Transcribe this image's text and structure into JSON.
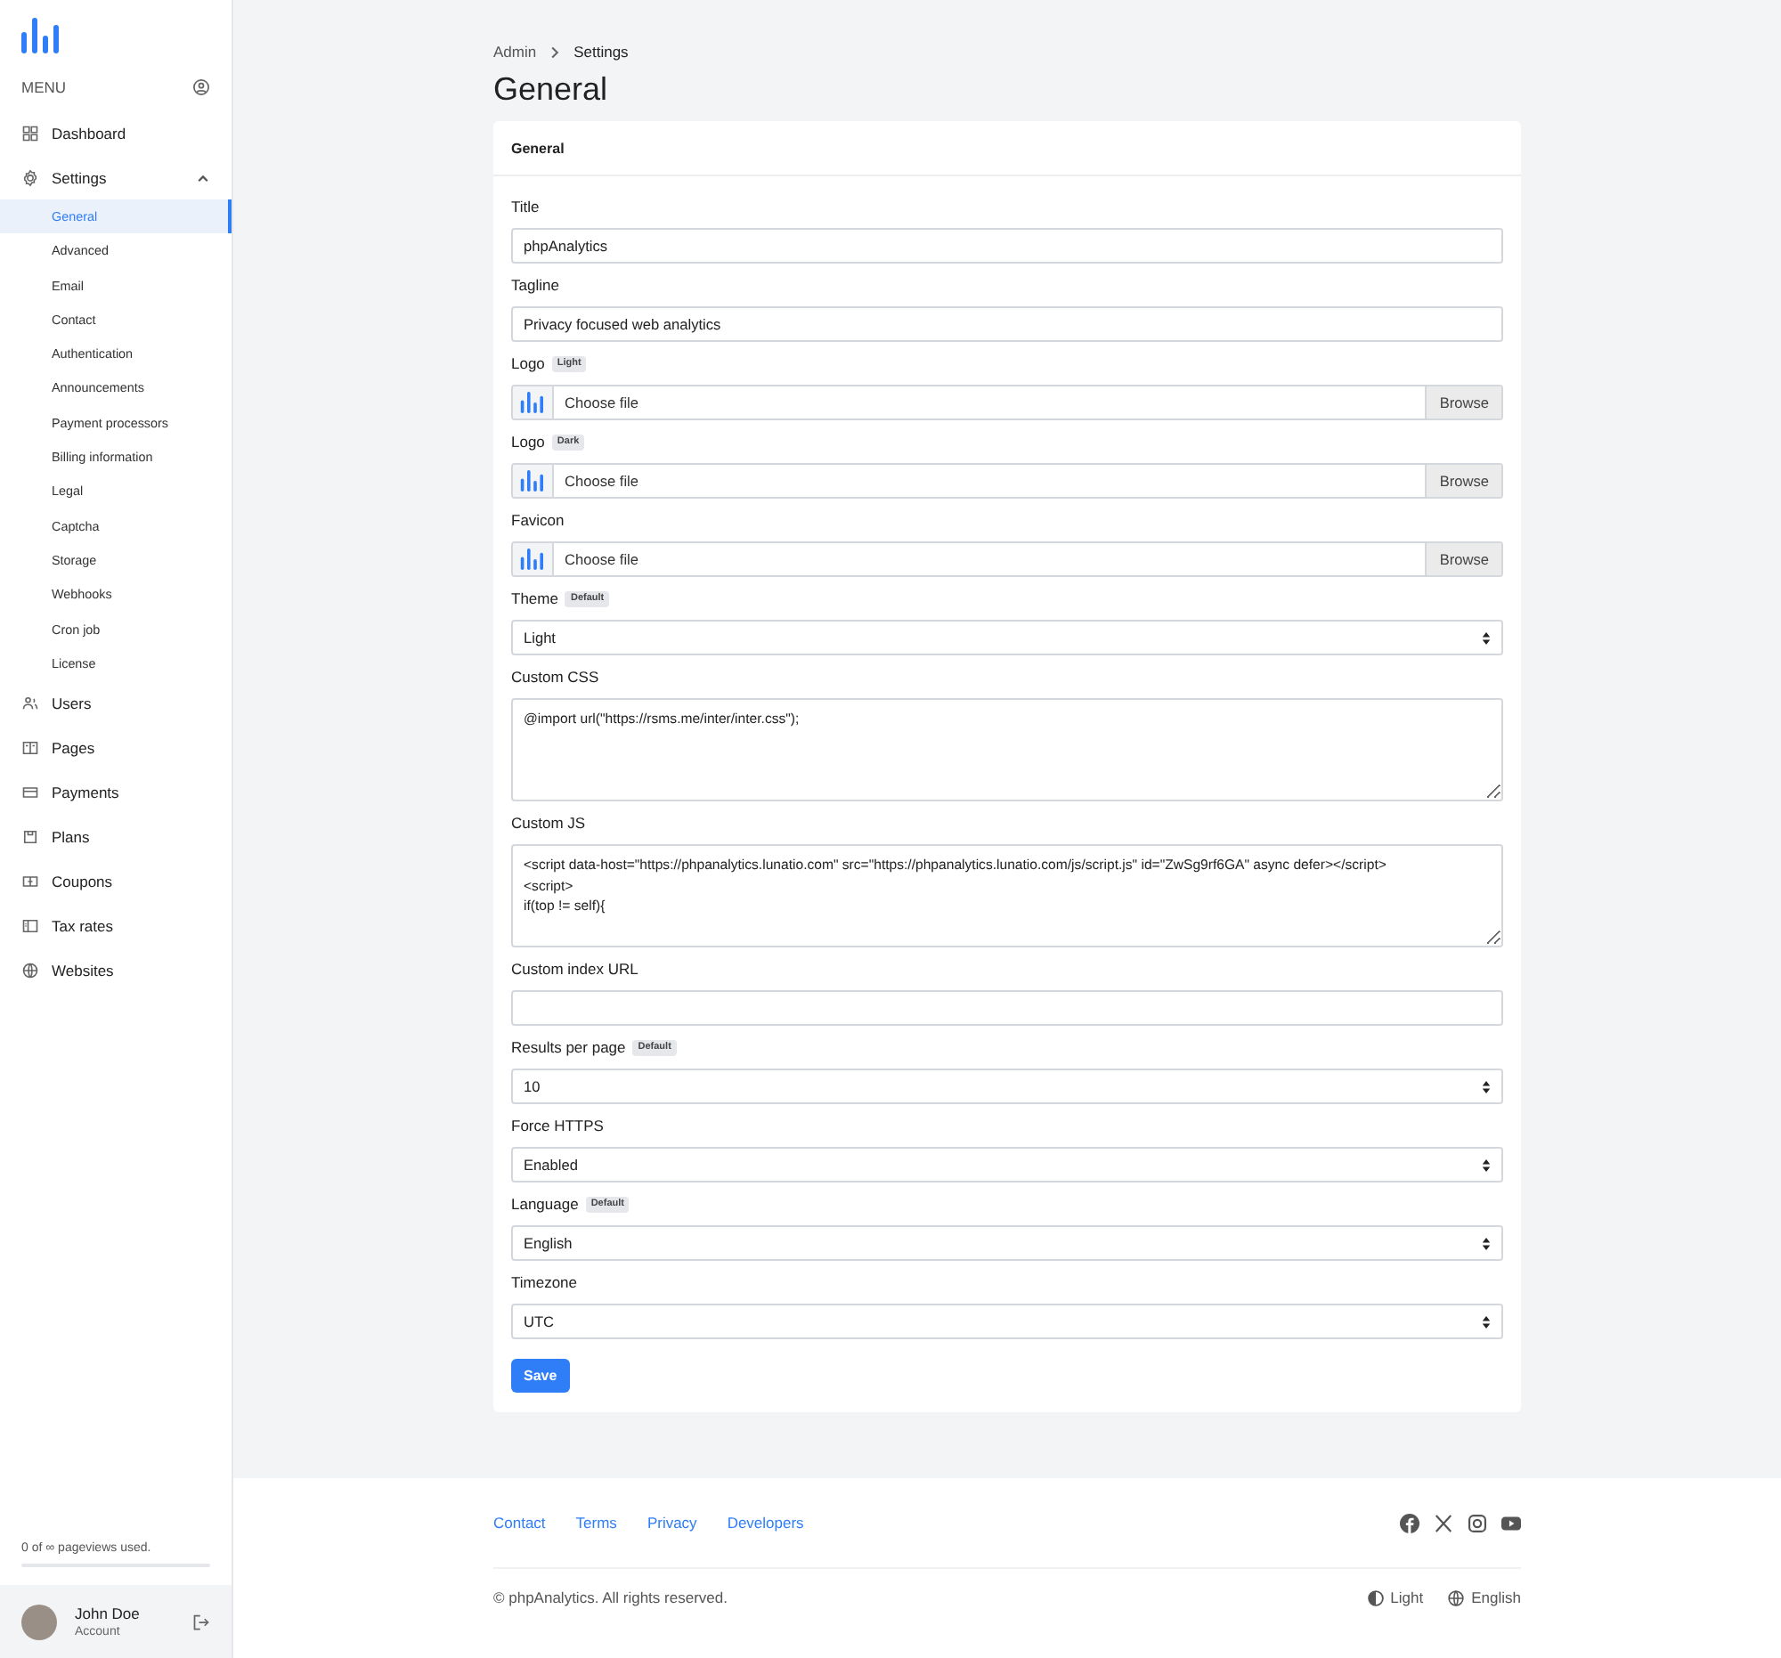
{
  "sidebar": {
    "menu_label": "MENU",
    "items": [
      {
        "label": "Dashboard"
      },
      {
        "label": "Settings",
        "expanded": true,
        "children": [
          {
            "label": "General",
            "selected": true
          },
          {
            "label": "Advanced",
            "selected": false
          },
          {
            "label": "Email",
            "selected": false
          },
          {
            "label": "Contact",
            "selected": false
          },
          {
            "label": "Authentication",
            "selected": false
          },
          {
            "label": "Announcements",
            "selected": false
          },
          {
            "label": "Payment processors",
            "selected": false
          },
          {
            "label": "Billing information",
            "selected": false
          },
          {
            "label": "Legal",
            "selected": false
          },
          {
            "label": "Captcha",
            "selected": false
          },
          {
            "label": "Storage",
            "selected": false
          },
          {
            "label": "Webhooks",
            "selected": false
          },
          {
            "label": "Cron job",
            "selected": false
          },
          {
            "label": "License",
            "selected": false
          }
        ]
      },
      {
        "label": "Users"
      },
      {
        "label": "Pages"
      },
      {
        "label": "Payments"
      },
      {
        "label": "Plans"
      },
      {
        "label": "Coupons"
      },
      {
        "label": "Tax rates"
      },
      {
        "label": "Websites"
      }
    ],
    "usage": {
      "text": "0 of ∞ pageviews used.",
      "level": 0
    },
    "user": {
      "name": "John Doe",
      "subtitle": "Account"
    }
  },
  "breadcrumb": [
    "Admin",
    "Settings"
  ],
  "page_title": "General",
  "card": {
    "title": "General",
    "fields": [
      {
        "kind": "text",
        "label": "Title",
        "value": "phpAnalytics"
      },
      {
        "kind": "text",
        "label": "Tagline",
        "value": "Privacy focused web analytics"
      },
      {
        "kind": "file",
        "label": "Logo",
        "badge": "Light",
        "placeholder": "Choose file",
        "button": "Browse"
      },
      {
        "kind": "file",
        "label": "Logo",
        "badge": "Dark",
        "placeholder": "Choose file",
        "button": "Browse"
      },
      {
        "kind": "file",
        "label": "Favicon",
        "placeholder": "Choose file",
        "button": "Browse"
      },
      {
        "kind": "select",
        "label": "Theme",
        "badge": "Default",
        "value": "Light"
      },
      {
        "kind": "textarea",
        "label": "Custom CSS",
        "value": "@import url(\"https://rsms.me/inter/inter.css\");"
      },
      {
        "kind": "textarea",
        "label": "Custom JS",
        "value": "<script data-host=\"https://phpanalytics.lunatio.com\" src=\"https://phpanalytics.lunatio.com/js/script.js\" id=\"ZwSg9rf6GA\" async defer></script>\n<script>\nif(top != self){"
      },
      {
        "kind": "text",
        "label": "Custom index URL"
      },
      {
        "kind": "select",
        "label": "Results per page",
        "badge": "Default",
        "value": "10"
      },
      {
        "kind": "select",
        "label": "Force HTTPS",
        "value": "Enabled"
      },
      {
        "kind": "select",
        "label": "Language",
        "badge": "Default",
        "value": "English"
      },
      {
        "kind": "select",
        "label": "Timezone",
        "value": "UTC"
      }
    ],
    "save_button": "Save"
  },
  "footer": {
    "links": [
      "Contact",
      "Terms",
      "Privacy",
      "Developers"
    ],
    "copyright": "© phpAnalytics. All rights reserved.",
    "theme": "Light",
    "language": "English"
  }
}
